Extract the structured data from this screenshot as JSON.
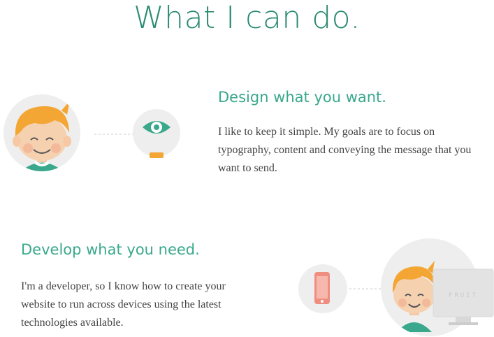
{
  "page": {
    "title": "What I can do."
  },
  "design": {
    "heading": "Design what you want.",
    "text": "I like to keep it simple. My goals are to focus on typography, content and conveying the message that you want to send."
  },
  "develop": {
    "heading": "Develop what you need.",
    "text": "I'm a developer, so I know how to create your website to run across devices using the latest technologies available.",
    "monitor_label": "FRUIT"
  },
  "colors": {
    "heading_teal": "#3aa88c",
    "title_teal": "#2a8a72",
    "hair_orange": "#f3a634",
    "shirt_green": "#3aa88c",
    "circle_gray": "#eeeeee"
  },
  "icons": [
    "boy-avatar-icon",
    "eye-icon",
    "phone-icon",
    "boy-at-computer-icon"
  ]
}
